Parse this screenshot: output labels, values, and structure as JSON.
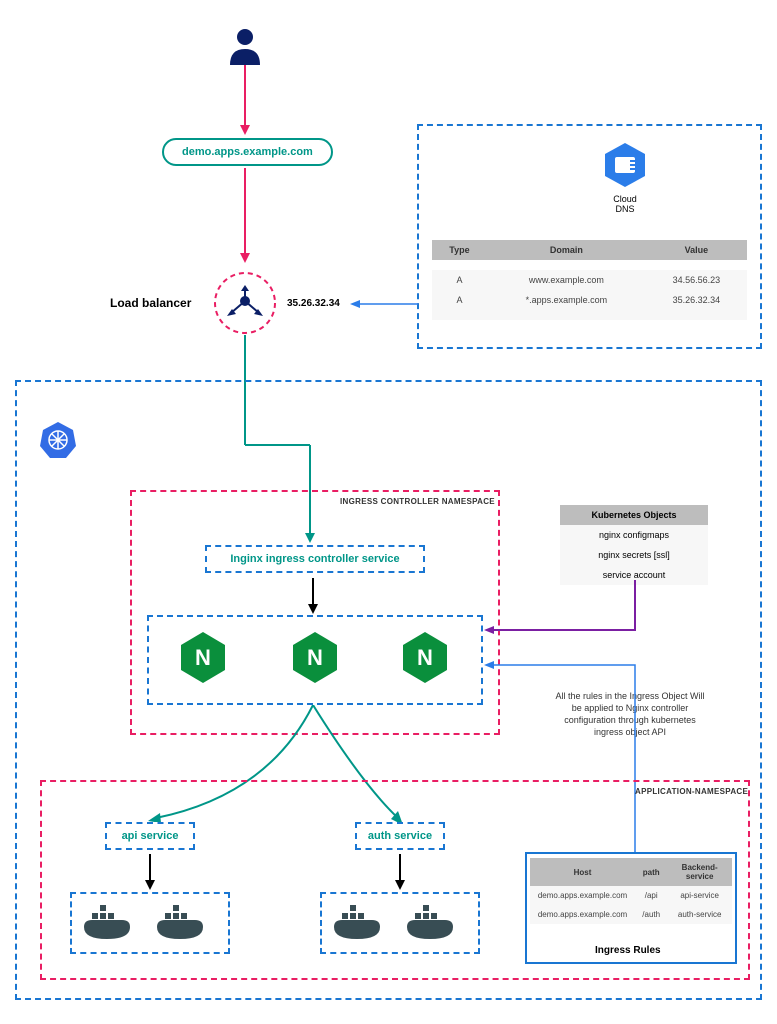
{
  "domain_pill": "demo.apps.example.com",
  "load_balancer_label": "Load balancer",
  "lb_ip": "35.26.32.34",
  "cloud_dns": {
    "title": "Cloud DNS",
    "headers": [
      "Type",
      "Domain",
      "Value"
    ],
    "rows": [
      [
        "A",
        "www.example.com",
        "34.56.56.23"
      ],
      [
        "A",
        "*.apps.example.com",
        "35.26.32.34"
      ]
    ]
  },
  "namespaces": {
    "ingress": "INGRESS CONTROLLER NAMESPACE",
    "app": "APPLICATION-NAMESPACE"
  },
  "services": {
    "ingress_controller": "Inginx ingress controller service",
    "api": "api service",
    "auth": "auth service"
  },
  "k8s_objects": {
    "title": "Kubernetes Objects",
    "rows": [
      "nginx configmaps",
      "nginx secrets [ssl]",
      "service account"
    ]
  },
  "ingress_note": "All the rules in the Ingress Object Will be applied to Nginx controller configuration through kubernetes ingress object API",
  "ingress_rules": {
    "headers": [
      "Host",
      "path",
      "Backend-service"
    ],
    "rows": [
      [
        "demo.apps.example.com",
        "/api",
        "api-service"
      ],
      [
        "demo.apps.example.com",
        "/auth",
        "auth-service"
      ]
    ],
    "title": "Ingress Rules"
  }
}
